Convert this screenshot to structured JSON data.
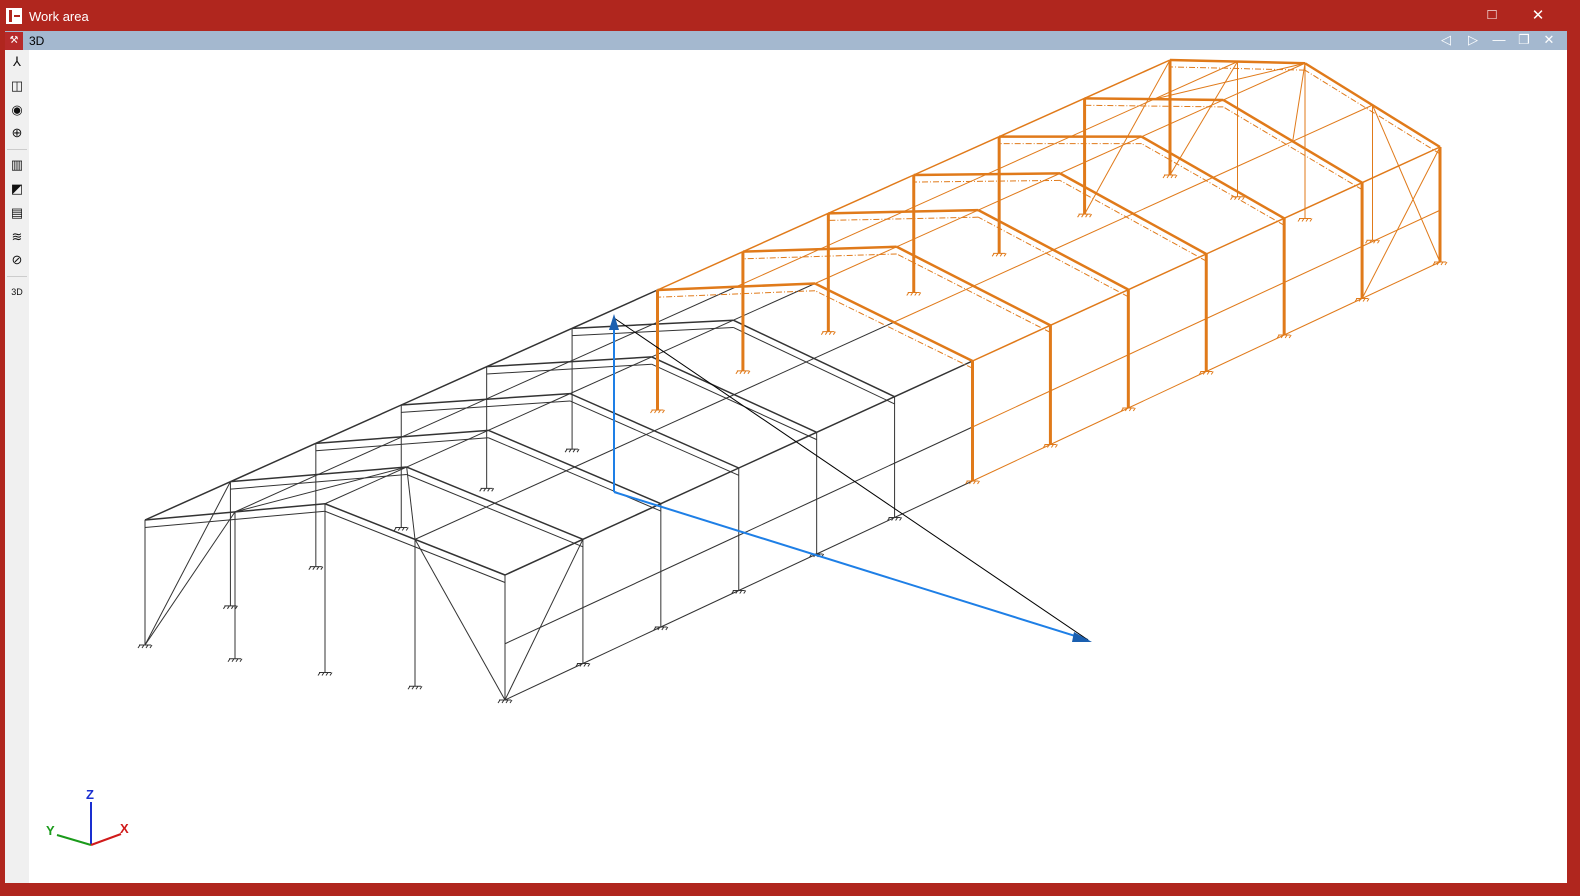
{
  "window": {
    "title": "Work area",
    "maximize_icon": "□",
    "close_icon": "✕"
  },
  "view_tab": {
    "title": "3D",
    "prev_icon": "◁",
    "next_icon": "▷",
    "minimize_icon": "—",
    "restore_icon": "❐",
    "close_icon": "✕"
  },
  "toolbar": [
    {
      "name": "axes-icon",
      "glyph": "⅄"
    },
    {
      "name": "cube-view-icon",
      "glyph": "◫"
    },
    {
      "name": "orbit-icon",
      "glyph": "◉"
    },
    {
      "name": "rotate-icon",
      "glyph": "⊕"
    },
    {
      "name": "section-plane-icon",
      "glyph": "▥"
    },
    {
      "name": "diagonal-plane-icon",
      "glyph": "◩"
    },
    {
      "name": "horizontal-plane-icon",
      "glyph": "▤"
    },
    {
      "name": "layers-icon",
      "glyph": "≋"
    },
    {
      "name": "hide-icon",
      "glyph": "⊘"
    },
    {
      "name": "3d-settings-icon",
      "glyph": "3D"
    }
  ],
  "axes": {
    "x": "X",
    "y": "Y",
    "z": "Z"
  },
  "colors": {
    "selected": "#e07a1a",
    "unselected": "#333333",
    "arrow": "#1e7fe6",
    "titlebar": "#b0261e",
    "subbar": "#a4b8cf"
  }
}
